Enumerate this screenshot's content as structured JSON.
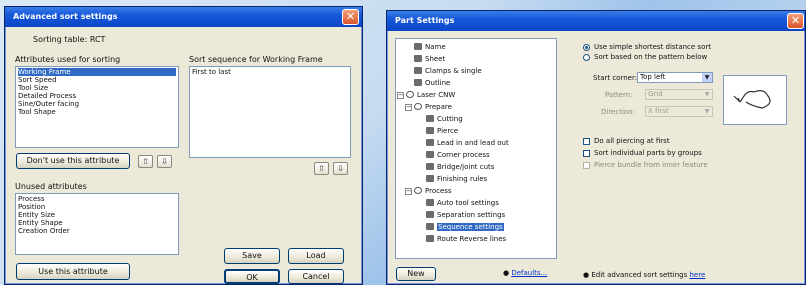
{
  "left_dialog": {
    "title": "Advanced sort settings",
    "sorting_table": "Sorting table: RCT",
    "attributes_label": "Attributes used for sorting",
    "attributes": [
      "Working Frame",
      "Sort Speed",
      "Tool Size",
      "Detailed Process",
      "Sine/Outer facing",
      "Tool Shape"
    ],
    "selected_attribute_index": 0,
    "sequence_label": "Sort sequence for Working Frame",
    "sequence_items": [
      "First to last"
    ],
    "dont_use_button": "Don't use this attribute",
    "unused_label": "Unused attributes",
    "unused_attributes": [
      "Process",
      "Position",
      "Entity Size",
      "Entity Shape",
      "Creation Order"
    ],
    "use_button": "Use this attribute",
    "save_button": "Save",
    "load_button": "Load",
    "ok_button": "OK",
    "cancel_button": "Cancel"
  },
  "right_dialog": {
    "title": "Part Settings",
    "tree": [
      {
        "label": "Name",
        "level": 1
      },
      {
        "label": "Sheet",
        "level": 1
      },
      {
        "label": "Clamps & single",
        "level": 1
      },
      {
        "label": "Outline",
        "level": 1
      },
      {
        "label": "Laser CNW",
        "level": 0
      },
      {
        "label": "Prepare",
        "level": 1
      },
      {
        "label": "Cutting",
        "level": 2
      },
      {
        "label": "Pierce",
        "level": 2
      },
      {
        "label": "Lead in and lead out",
        "level": 2
      },
      {
        "label": "Corner process",
        "level": 2
      },
      {
        "label": "Bridge/joint cuts",
        "level": 2
      },
      {
        "label": "Finishing rules",
        "level": 2
      },
      {
        "label": "Process",
        "level": 1
      },
      {
        "label": "Auto tool settings",
        "level": 2
      },
      {
        "label": "Separation settings",
        "level": 2
      },
      {
        "label": "Sequence settings",
        "level": 2
      },
      {
        "label": "Route Reverse lines",
        "level": 2
      }
    ],
    "selected_tree_index": 15,
    "new_button": "New",
    "defaults_link": "Defaults...",
    "radio_simple": "Use simple shortest distance sort",
    "radio_pattern": "Sort based on the pattern below",
    "start_corner_label": "Start corner:",
    "start_corner_value": "Top left",
    "pattern_label": "Pattern:",
    "pattern_value": "Grid",
    "direction_label": "Direction:",
    "direction_value": "X first",
    "check_all_piercing": "Do all piercing at first",
    "check_individual": "Sort individual parts by groups",
    "check_dim": "Pierce bundle from inner feature",
    "advanced_text": "Edit advanced sort settings",
    "advanced_link": "here"
  }
}
